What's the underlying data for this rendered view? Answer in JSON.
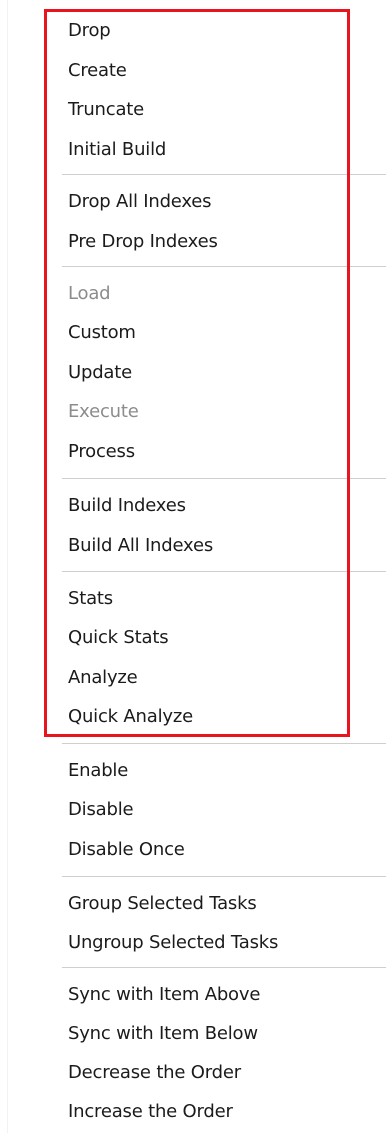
{
  "colors": {
    "highlight_border": "#e8141e",
    "text": "#1b1b1b",
    "disabled_text": "#8c8c8c",
    "separator": "#cfcfcf",
    "background": "#ffffff"
  },
  "menu": {
    "items": [
      {
        "label": "Drop",
        "enabled": true
      },
      {
        "label": "Create",
        "enabled": true
      },
      {
        "label": "Truncate",
        "enabled": true
      },
      {
        "label": "Initial Build",
        "enabled": true
      },
      {
        "label": "Drop All Indexes",
        "enabled": true
      },
      {
        "label": "Pre Drop Indexes",
        "enabled": true
      },
      {
        "label": "Load",
        "enabled": false
      },
      {
        "label": "Custom",
        "enabled": true
      },
      {
        "label": "Update",
        "enabled": true
      },
      {
        "label": "Execute",
        "enabled": false
      },
      {
        "label": "Process",
        "enabled": true
      },
      {
        "label": "Build Indexes",
        "enabled": true
      },
      {
        "label": "Build All Indexes",
        "enabled": true
      },
      {
        "label": "Stats",
        "enabled": true
      },
      {
        "label": "Quick Stats",
        "enabled": true
      },
      {
        "label": "Analyze",
        "enabled": true
      },
      {
        "label": "Quick Analyze",
        "enabled": true
      },
      {
        "label": "Enable",
        "enabled": true
      },
      {
        "label": "Disable",
        "enabled": true
      },
      {
        "label": "Disable Once",
        "enabled": true
      },
      {
        "label": "Group Selected Tasks",
        "enabled": true
      },
      {
        "label": "Ungroup Selected Tasks",
        "enabled": true
      },
      {
        "label": "Sync with Item Above",
        "enabled": true
      },
      {
        "label": "Sync with Item Below",
        "enabled": true
      },
      {
        "label": "Decrease the Order",
        "enabled": true
      },
      {
        "label": "Increase the Order",
        "enabled": true
      }
    ]
  }
}
